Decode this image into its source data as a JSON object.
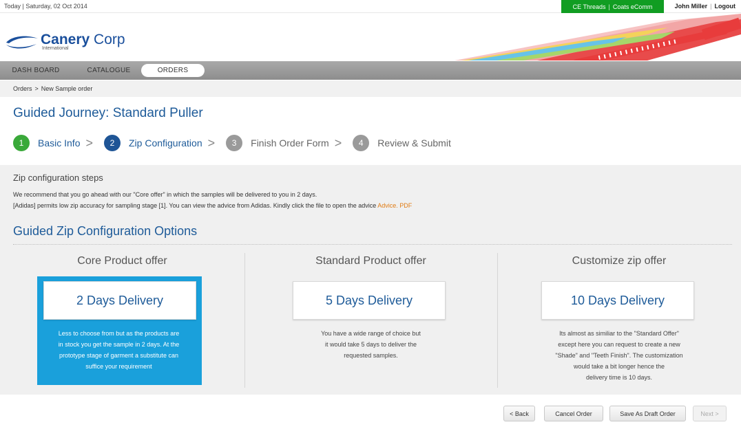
{
  "topbar": {
    "date": "Today  |  Saturday, 02 Oct 2014",
    "threads_link": "CE Threads",
    "sep": "|",
    "ecomm_link": "Coats eComm",
    "user_name": "John Miller",
    "logout": "Logout"
  },
  "brand": {
    "name_bold": "Canery",
    "name_rest": " Corp",
    "sub": "International"
  },
  "nav": {
    "tabs": [
      {
        "label": "DASH BOARD"
      },
      {
        "label": "CATALOGUE"
      },
      {
        "label": "ORDERS"
      }
    ],
    "active": "ORDERS"
  },
  "breadcrumb": {
    "root": "Orders",
    "sep": ">",
    "current": "New Sample order"
  },
  "page_title": "Guided Journey: Standard Puller",
  "steps": [
    {
      "num": "1",
      "label": "Basic Info",
      "color": "#3aa93a"
    },
    {
      "num": "2",
      "label": "Zip Configuration",
      "color": "#1f5596"
    },
    {
      "num": "3",
      "label": "Finish Order Form",
      "color": "#9a9a9a"
    },
    {
      "num": "4",
      "label": "Review & Submit",
      "color": "#9a9a9a"
    }
  ],
  "chevron": ">",
  "zip_steps": {
    "title": "Zip configuration steps",
    "line1": "We recommend that you go ahead with our \"Core offer\" in which the samples will be delivered to you in 2 days.",
    "line2": "[Adidas] permits low zip accuracy for sampling stage [1]. You can view the advice from Adidas. Kindly click the file to open the advice ",
    "link": "Advice. PDF"
  },
  "options_title": "Guided Zip Configuration Options",
  "options": [
    {
      "heading": "Core Product offer",
      "card": "2 Days Delivery",
      "desc": [
        "Less to choose from but as the products are",
        "in stock you get the sample in 2 days. At the",
        "prototype stage of garment a substitute can",
        "suffice your requirement"
      ]
    },
    {
      "heading": "Standard Product offer",
      "card": "5 Days Delivery",
      "desc": [
        "You have a wide range of choice but",
        "it would take 5 days to deliver the",
        "requested samples."
      ]
    },
    {
      "heading": "Customize zip offer",
      "card": "10 Days Delivery",
      "desc": [
        "Its almost as similiar to the \"Standard Offer\"",
        "except here you can request to create a new",
        "\"Shade\" and \"Teeth Finish\". The customization",
        "would take a bit longer hence the",
        "delivery time is 10 days."
      ]
    }
  ],
  "buttons": {
    "back": "< Back",
    "cancel": "Cancel Order",
    "draft": "Save As Draft Order",
    "next": "Next >"
  },
  "colors": {
    "accent": "#1e5b99",
    "selected": "#1aa0db",
    "green": "#119d22",
    "link": "#e07b13"
  },
  "icons": {
    "logo": "canery-swoosh-logo"
  }
}
